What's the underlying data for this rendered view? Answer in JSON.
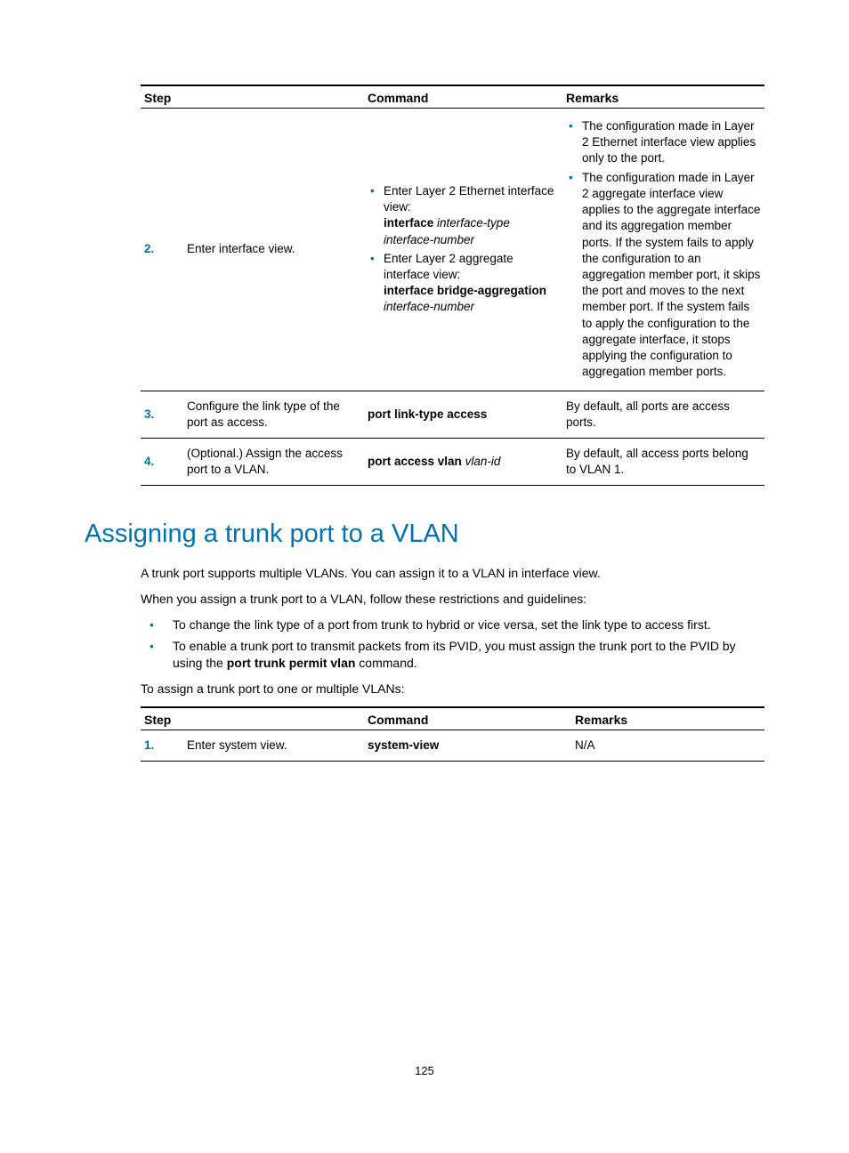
{
  "table1": {
    "headers": {
      "step": "Step",
      "command": "Command",
      "remarks": "Remarks"
    },
    "rows": [
      {
        "num": "2.",
        "step": "Enter interface view.",
        "cmd_bullets": [
          {
            "pre": "Enter Layer 2 Ethernet interface view:",
            "bold1": "interface",
            "italic1": " interface-type interface-number"
          },
          {
            "pre": "Enter Layer 2 aggregate interface view:",
            "bold1": "interface bridge-aggregation",
            "italic1_nl": "interface-number"
          }
        ],
        "rem_bullets": [
          "The configuration made in Layer 2 Ethernet interface view applies only to the port.",
          "The configuration made in Layer 2 aggregate interface view applies to the aggregate interface and its aggregation member ports. If the system fails to apply the configuration to an aggregation member port, it skips the port and moves to the next member port. If the system fails to apply the configuration to the aggregate interface, it stops applying the configuration to aggregation member ports."
        ]
      },
      {
        "num": "3.",
        "step": "Configure the link type of the port as access.",
        "cmd_bold": "port link-type access",
        "remarks": "By default, all ports are access ports."
      },
      {
        "num": "4.",
        "step": "(Optional.) Assign the access port to a VLAN.",
        "cmd_bold": "port access vlan",
        "cmd_italic": " vlan-id",
        "remarks": "By default, all access ports belong to VLAN 1."
      }
    ]
  },
  "section": {
    "title": "Assigning a trunk port to a VLAN",
    "p1": "A trunk port supports multiple VLANs. You can assign it to a VLAN in interface view.",
    "p2": "When you assign a trunk port to a VLAN, follow these restrictions and guidelines:",
    "bullets": [
      {
        "text": "To change the link type of a port from trunk to hybrid or vice versa, set the link type to access first."
      },
      {
        "text_pre": "To enable a trunk port to transmit packets from its PVID, you must assign the trunk port to the PVID by using the ",
        "bold": "port trunk permit vlan",
        "text_post": " command."
      }
    ],
    "p3": "To assign a trunk port to one or multiple VLANs:"
  },
  "table2": {
    "headers": {
      "step": "Step",
      "command": "Command",
      "remarks": "Remarks"
    },
    "rows": [
      {
        "num": "1.",
        "step": "Enter system view.",
        "cmd_bold": "system-view",
        "remarks": "N/A"
      }
    ]
  },
  "page_num": "125"
}
